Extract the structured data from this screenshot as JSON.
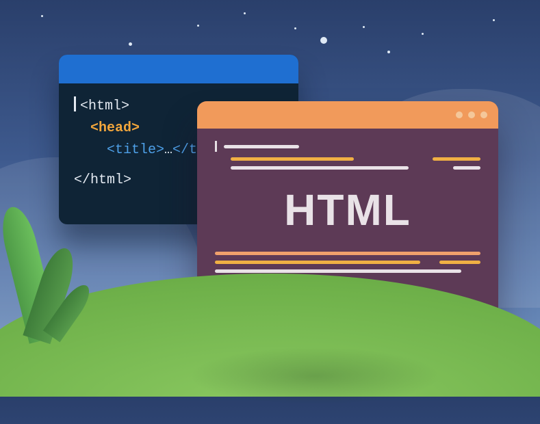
{
  "code_editor": {
    "lines": {
      "l1": "<html>",
      "l2": "<head>",
      "l3_open": "<title>",
      "l3_mid": "…",
      "l3_close": "</title>",
      "l4": "</html>"
    }
  },
  "browser": {
    "title": "HTML"
  }
}
